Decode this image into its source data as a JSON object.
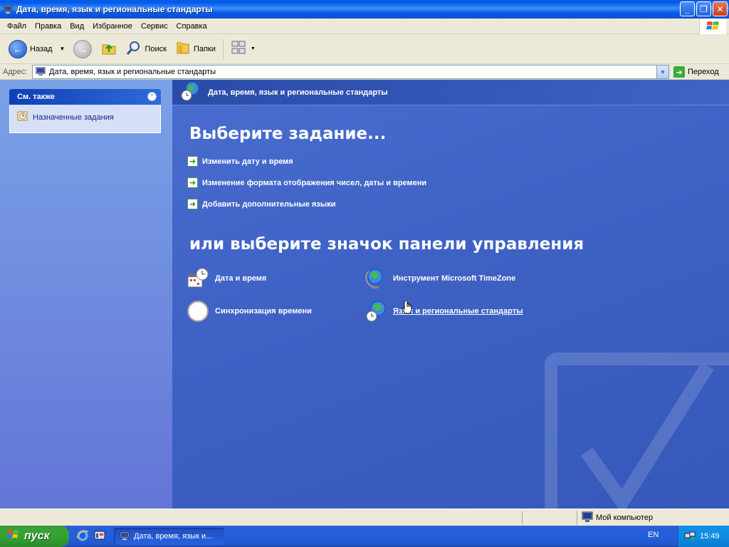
{
  "window": {
    "title": "Дата, время, язык и региональные стандарты"
  },
  "menu": [
    "Файл",
    "Правка",
    "Вид",
    "Избранное",
    "Сервис",
    "Справка"
  ],
  "toolbar": {
    "back": "Назад",
    "search": "Поиск",
    "folders": "Папки"
  },
  "address": {
    "label": "Адрес:",
    "value": "Дата, время, язык и региональные стандарты",
    "go": "Переход"
  },
  "see_also": {
    "header": "См. также",
    "items": [
      "Назначенные задания"
    ]
  },
  "main": {
    "header": "Дата, время, язык и региональные стандарты",
    "pick_task": "Выберите задание...",
    "tasks": [
      "Изменить дату и время",
      "Изменение формата отображения чисел, даты и времени",
      "Добавить дополнительные языки"
    ],
    "pick_icon": "или выберите значок панели управления",
    "icons": [
      "Дата и время",
      "Инструмент Microsoft TimeZone",
      "Синхронизация времени",
      "Язык и региональные стандарты"
    ]
  },
  "status": {
    "zone": "Мой компьютер"
  },
  "taskbar": {
    "start": "пуск",
    "active_window": "Дата, время, язык и...",
    "lang": "EN",
    "clock": "15:49"
  },
  "colors": {
    "title_blue": "#0058EE",
    "pane_blue": "#3F62C5",
    "start_green": "#34A734"
  }
}
